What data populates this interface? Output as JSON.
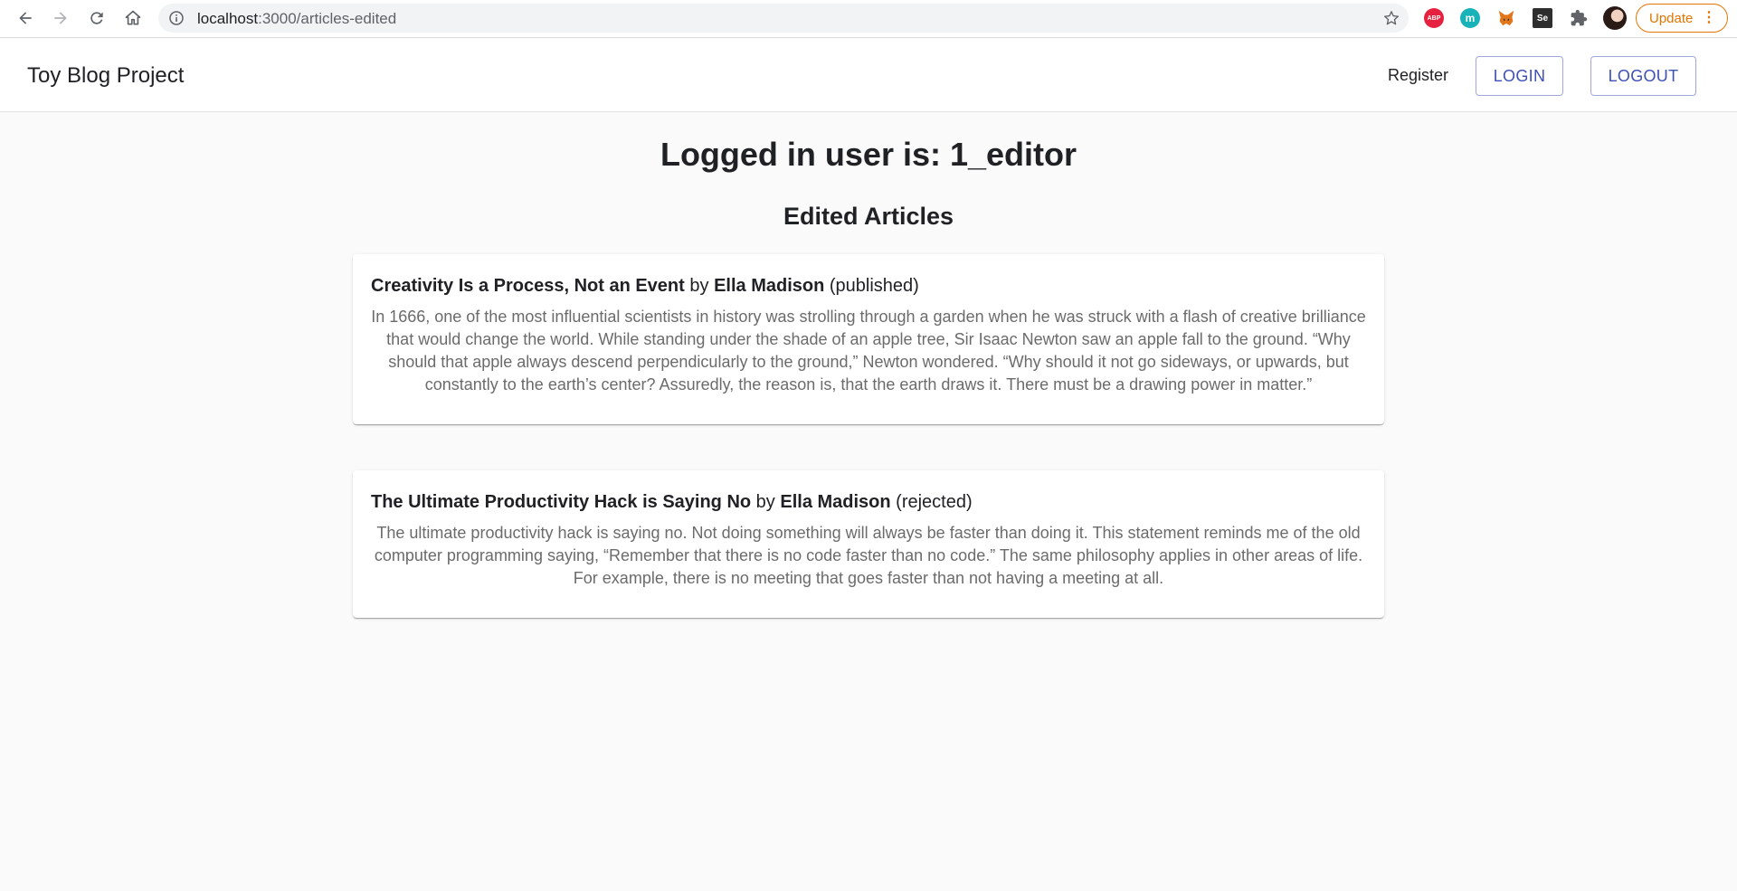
{
  "browser": {
    "url_host": "localhost",
    "url_path": ":3000/articles-edited",
    "update_label": "Update",
    "extensions": {
      "abp": "ABP",
      "m": "m",
      "se": "Se"
    }
  },
  "header": {
    "brand": "Toy Blog Project",
    "register_label": "Register",
    "login_label": "LOGIN",
    "logout_label": "LOGOUT"
  },
  "main": {
    "logged_user": "Logged in user is: 1_editor",
    "section_title": "Edited Articles",
    "articles": [
      {
        "title": "Creativity Is a Process, Not an Event",
        "by": "by",
        "author": "Ella Madison",
        "status": "(published)",
        "body": "In 1666, one of the most influential scientists in history was strolling through a garden when he was struck with a flash of creative brilliance that would change the world. While standing under the shade of an apple tree, Sir Isaac Newton saw an apple fall to the ground. “Why should that apple always descend perpendicularly to the ground,” Newton wondered. “Why should it not go sideways, or upwards, but constantly to the earth’s center? Assuredly, the reason is, that the earth draws it. There must be a drawing power in matter.”"
      },
      {
        "title": "The Ultimate Productivity Hack is Saying No",
        "by": "by",
        "author": "Ella Madison",
        "status": "(rejected)",
        "body": "The ultimate productivity hack is saying no. Not doing something will always be faster than doing it. This statement reminds me of the old computer programming saying, “Remember that there is no code faster than no code.” The same philosophy applies in other areas of life. For example, there is no meeting that goes faster than not having a meeting at all."
      }
    ]
  },
  "colors": {
    "accent": "#3f51b5",
    "update": "#e37400",
    "background": "#fafafa"
  }
}
